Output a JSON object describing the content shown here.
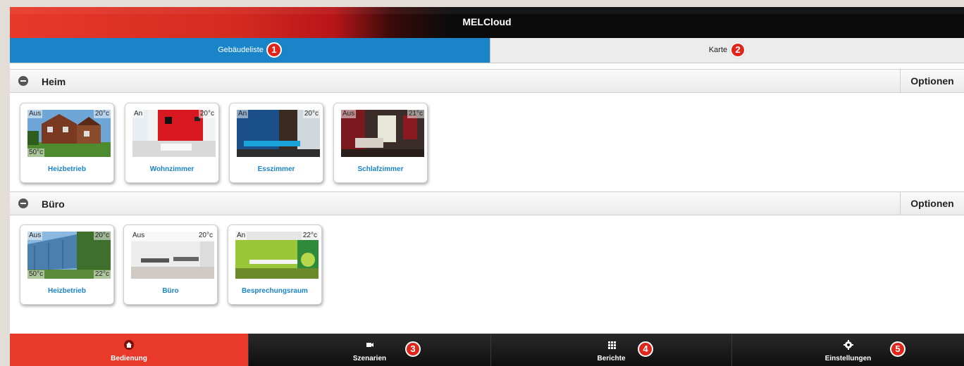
{
  "app": {
    "title": "MELCloud"
  },
  "tabs": [
    {
      "label": "Gebäudeliste",
      "badge": "1"
    },
    {
      "label": "Karte",
      "badge": "2"
    }
  ],
  "sections": [
    {
      "name": "Heim",
      "options_label": "Optionen",
      "cards": [
        {
          "label": "Heizbetrieb",
          "status": "Aus",
          "room_temp": "20°c",
          "water_temp": "50°c"
        },
        {
          "label": "Wohnzimmer",
          "status": "An",
          "room_temp": "20°c"
        },
        {
          "label": "Esszimmer",
          "status": "An",
          "room_temp": "20°c"
        },
        {
          "label": "Schlafzimmer",
          "status": "Aus",
          "room_temp": "21°c"
        }
      ]
    },
    {
      "name": "Büro",
      "options_label": "Optionen",
      "cards": [
        {
          "label": "Heizbetrieb",
          "status": "Aus",
          "room_temp": "20°c",
          "water_temp": "50°c",
          "outdoor_temp": "22°c"
        },
        {
          "label": "Büro",
          "status": "Aus",
          "room_temp": "20°c"
        },
        {
          "label": "Besprechungsraum",
          "status": "An",
          "room_temp": "22°c"
        }
      ]
    }
  ],
  "bottom_nav": [
    {
      "label": "Bedienung",
      "icon": "home-icon",
      "active": true
    },
    {
      "label": "Szenarien",
      "icon": "video-camera-icon",
      "badge": "3"
    },
    {
      "label": "Berichte",
      "icon": "grid-icon",
      "badge": "4"
    },
    {
      "label": "Einstellungen",
      "icon": "gear-icon",
      "badge": "5"
    }
  ],
  "colors": {
    "accent_blue": "#1a84c8",
    "accent_red": "#e8392b",
    "badge_red": "#e1251b"
  }
}
